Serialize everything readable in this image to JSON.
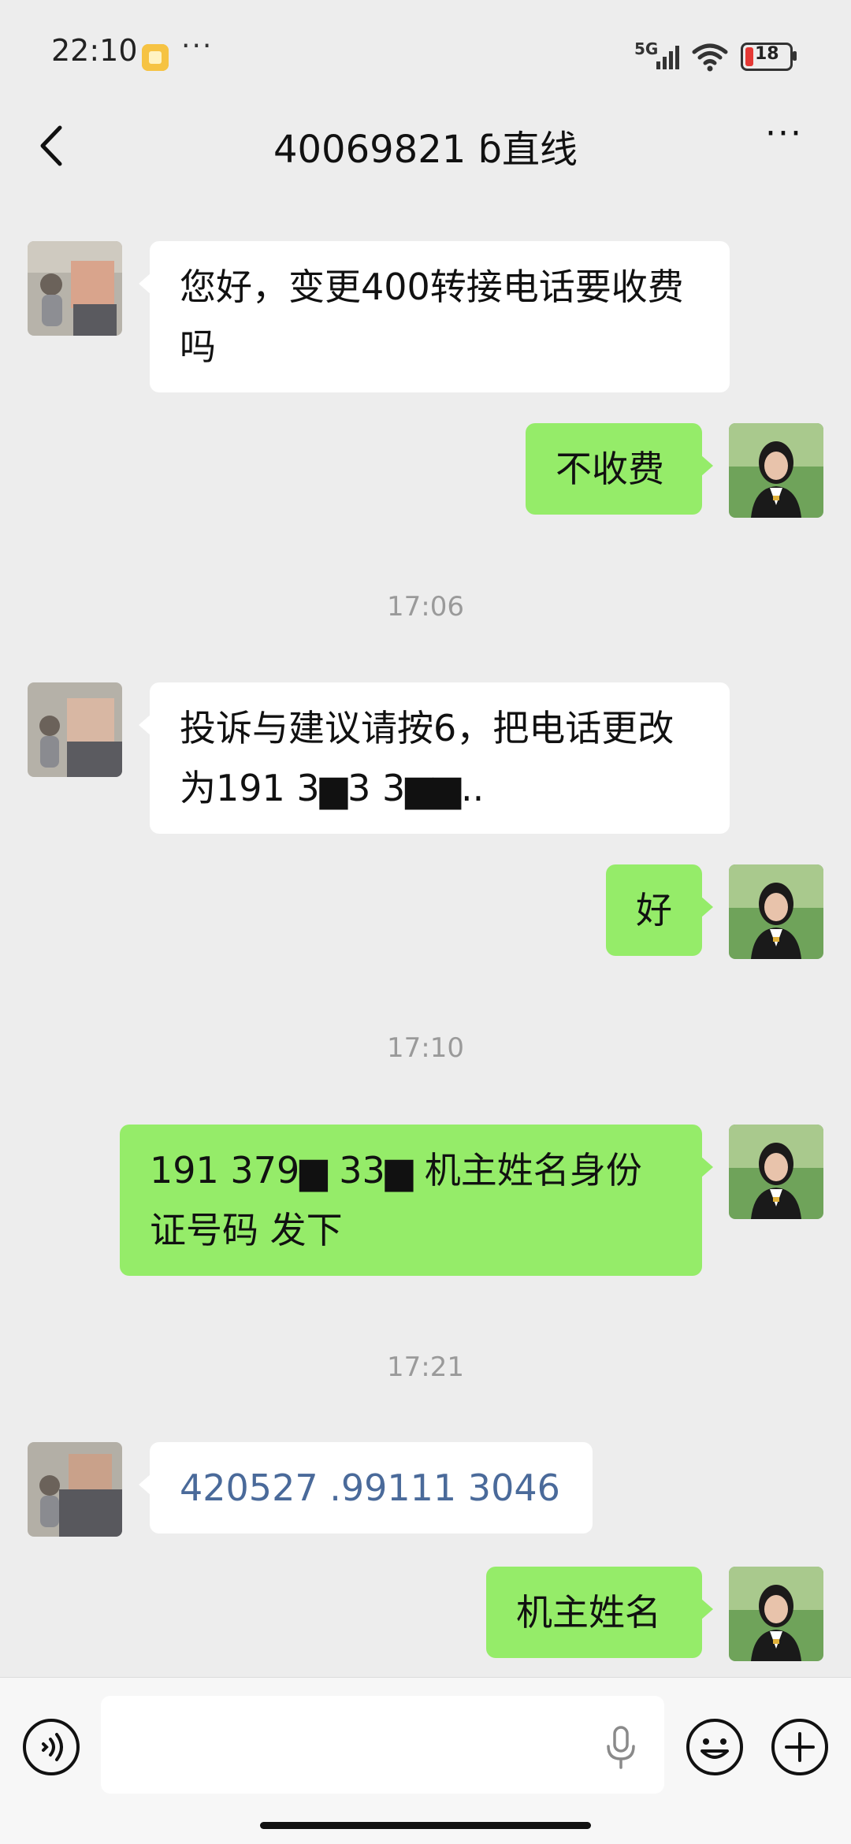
{
  "status_bar": {
    "time": "22:10",
    "more": "···",
    "network": "5G",
    "battery": "18"
  },
  "header": {
    "title": "40069821 ⁠⁠⁠⁠⁠ɓ直线",
    "more": "···"
  },
  "messages": [
    {
      "type": "incoming",
      "text": "您好，变更400转接电话要收费吗"
    },
    {
      "type": "outgoing",
      "text": "不收费"
    },
    {
      "type": "time",
      "text": "17:06"
    },
    {
      "type": "incoming",
      "text": "投诉与建议请按6，把电话更改为191 3▆3  3▆▆.."
    },
    {
      "type": "outgoing",
      "text": "好"
    },
    {
      "type": "time",
      "text": "17:10"
    },
    {
      "type": "outgoing",
      "text": "191 379▆  33▆  机主姓名身份证号码  发下"
    },
    {
      "type": "time",
      "text": "17:21"
    },
    {
      "type": "incoming",
      "text": "420527  .99111  3046"
    },
    {
      "type": "outgoing",
      "text": "机主姓名"
    }
  ],
  "colors": {
    "background": "#ededed",
    "outgoing_bubble": "#95ec69",
    "incoming_bubble": "#ffffff",
    "timestamp": "#9a9a9a",
    "id_text": "#4a6a9a"
  }
}
